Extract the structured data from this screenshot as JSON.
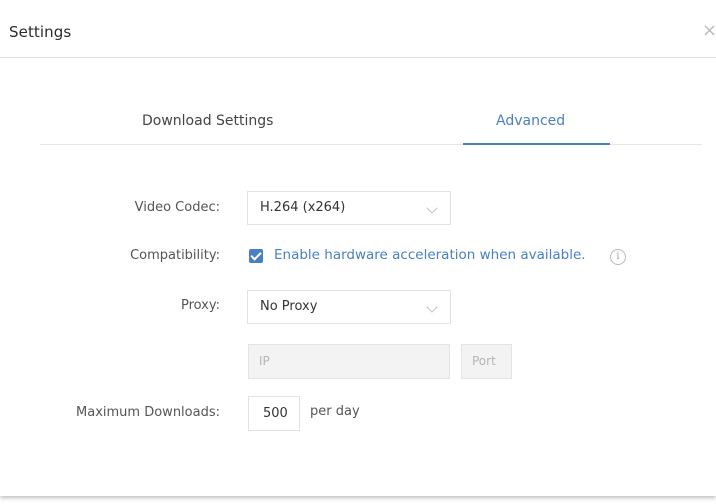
{
  "window": {
    "title": "Settings",
    "close_glyph": "×"
  },
  "tabs": [
    {
      "label": "Download Settings",
      "active": false
    },
    {
      "label": "Advanced",
      "active": true
    }
  ],
  "form": {
    "video_codec": {
      "label": "Video Codec:",
      "value": "H.264 (x264)"
    },
    "compatibility": {
      "label": "Compatibility:",
      "checkbox_checked": true,
      "checkbox_label": "Enable hardware acceleration when available.",
      "info_glyph": "i"
    },
    "proxy": {
      "label": "Proxy:",
      "value": "No Proxy",
      "ip_placeholder": "IP",
      "port_placeholder": "Port"
    },
    "max_downloads": {
      "label": "Maximum Downloads:",
      "value": "500",
      "unit": "per day"
    }
  },
  "colors": {
    "accent": "#4a7fc1",
    "disabled_field": "#f3f3f3"
  },
  "icons": [
    "close-icon",
    "chevron-down-icon",
    "check-icon",
    "info-icon"
  ]
}
